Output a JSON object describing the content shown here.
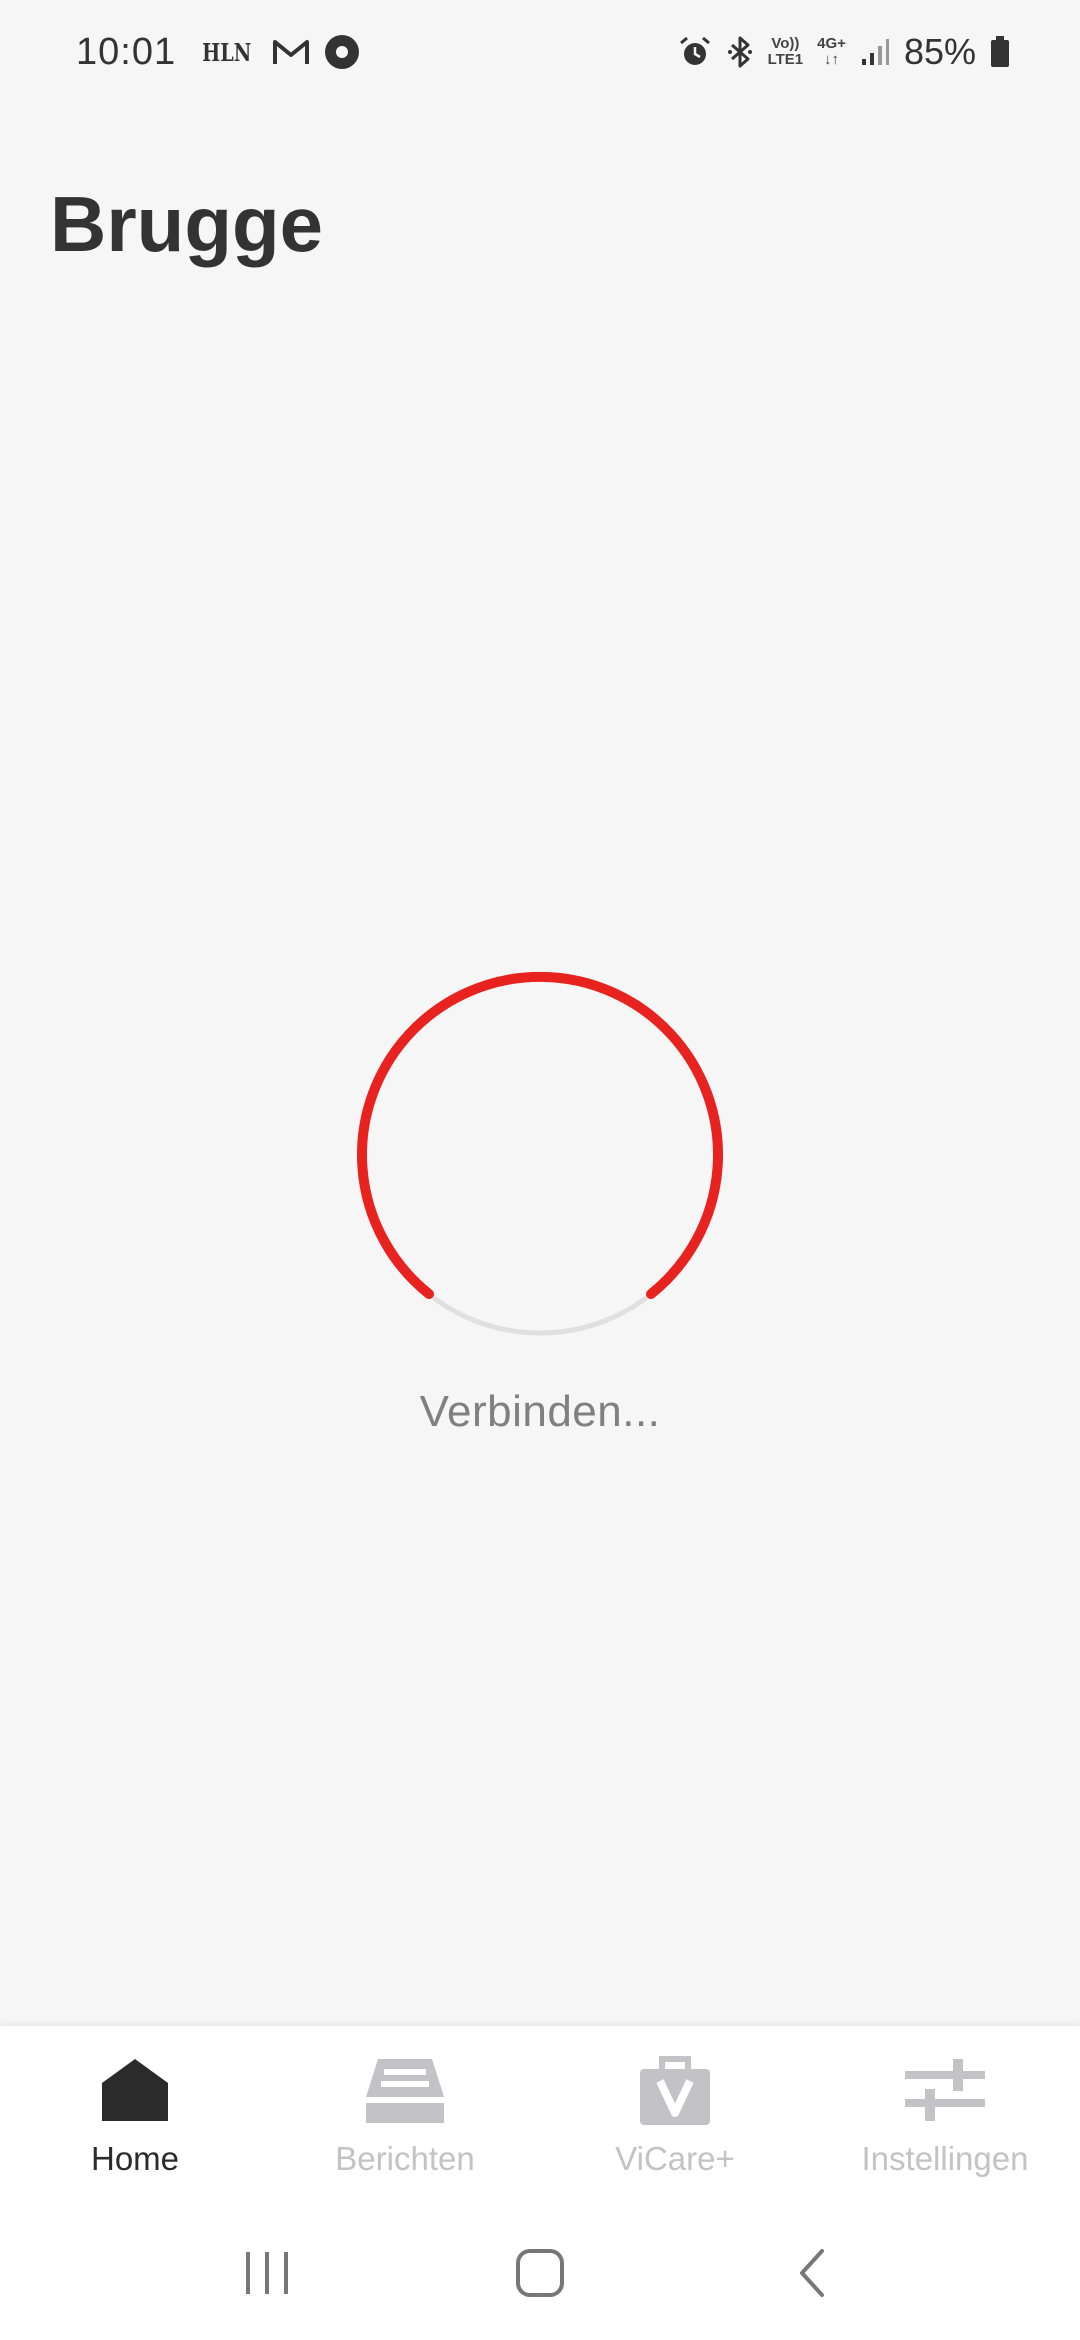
{
  "status_bar": {
    "time": "10:01",
    "hln_label": "HLN",
    "network_top": "Vo))",
    "network_bottom": "LTE1",
    "network_type": "4G+",
    "battery_percent": "85%"
  },
  "header": {
    "title": "Brugge"
  },
  "loading": {
    "text": "Verbinden...",
    "accent_color": "#e8231f",
    "track_color": "#e0e0e0"
  },
  "bottom_nav": {
    "items": [
      {
        "label": "Home",
        "icon": "home-icon",
        "active": true
      },
      {
        "label": "Berichten",
        "icon": "inbox-icon",
        "active": false
      },
      {
        "label": "ViCare+",
        "icon": "vicare-bag-icon",
        "active": false
      },
      {
        "label": "Instellingen",
        "icon": "sliders-icon",
        "active": false
      }
    ]
  },
  "colors": {
    "background": "#f6f6f6",
    "nav_active": "#2b2b2b",
    "nav_inactive": "#c3c3c7"
  }
}
